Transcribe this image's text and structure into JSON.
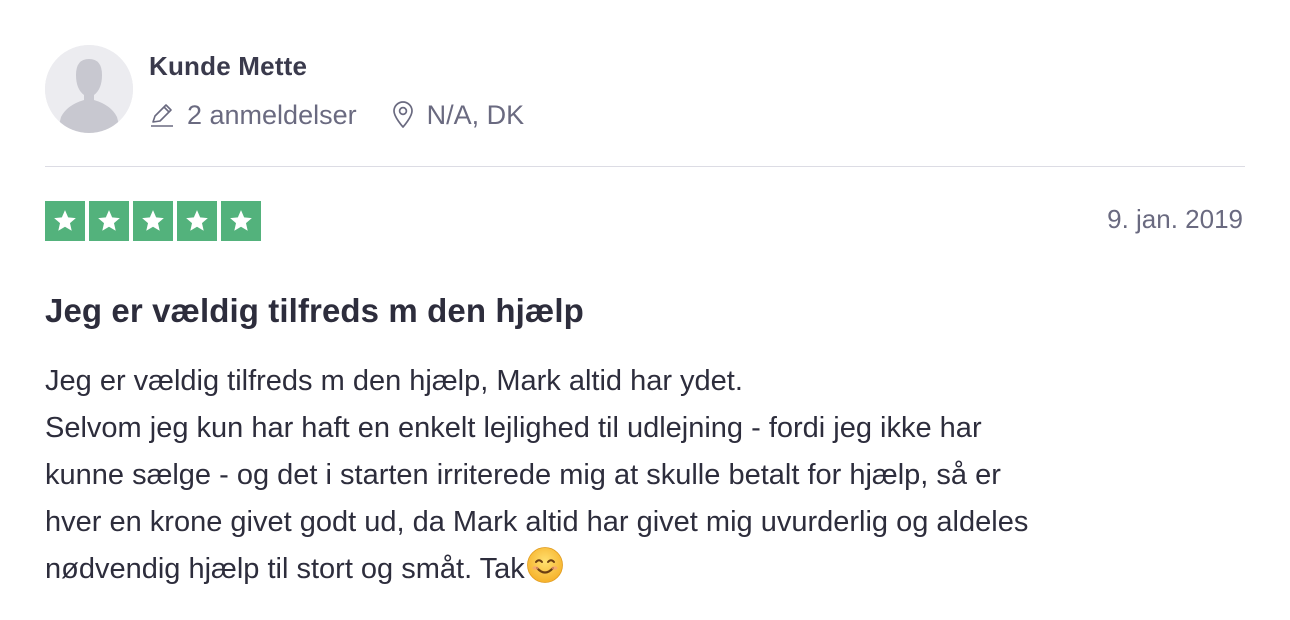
{
  "consumer": {
    "name": "Kunde Mette",
    "reviews_count": "2 anmeldelser",
    "location": "N/A, DK"
  },
  "review": {
    "rating": 5,
    "rating_max": 5,
    "star_color": "#53b27c",
    "date": "9. jan. 2019",
    "title": "Jeg er vældig tilfreds m den hjælp",
    "body_lines": [
      "Jeg er vældig tilfreds m den hjælp, Mark altid har ydet.",
      "Selvom jeg kun har haft en enkelt lejlighed til udlejning - fordi jeg ikke har",
      "kunne sælge - og det i starten irriterede mig at skulle betalt for hjælp, så er",
      "hver en krone givet godt ud, da Mark altid har givet mig uvurderlig og aldeles",
      "nødvendig hjælp til stort og småt. Tak"
    ],
    "trailing_emoji": "smiling-face-emoji"
  }
}
